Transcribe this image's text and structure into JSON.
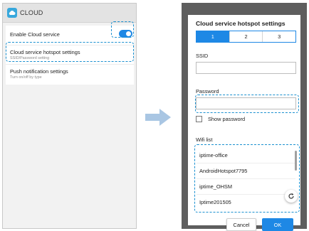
{
  "accent_color": "#1e88e5",
  "highlight_color": "#1a90d0",
  "left_screen": {
    "header_title": "CLOUD",
    "header_icon": "cloud-icon",
    "enable_cloud_label": "Enable Cloud service",
    "enable_cloud_on": true,
    "hotspot_title": "Cloud service hotspot settings",
    "hotspot_subtitle": "SSID/Password setting",
    "push_title": "Push notification settings",
    "push_subtitle": "Turn on/off by type"
  },
  "dialog": {
    "title": "Cloud service hotspot settings",
    "tabs": [
      "1",
      "2",
      "3"
    ],
    "selected_tab": "1",
    "ssid_label": "SSID",
    "ssid_value": "",
    "password_label": "Password",
    "password_value": "",
    "show_password_label": "Show password",
    "show_password_checked": false,
    "wifi_list_label": "Wifi list",
    "wifi_list": [
      "iptime-office",
      "AndroidHotspot7795",
      "iptime_OHSM",
      "Iptime201505"
    ],
    "refresh_icon": "refresh-icon",
    "cancel_label": "Cancel",
    "ok_label": "OK"
  }
}
